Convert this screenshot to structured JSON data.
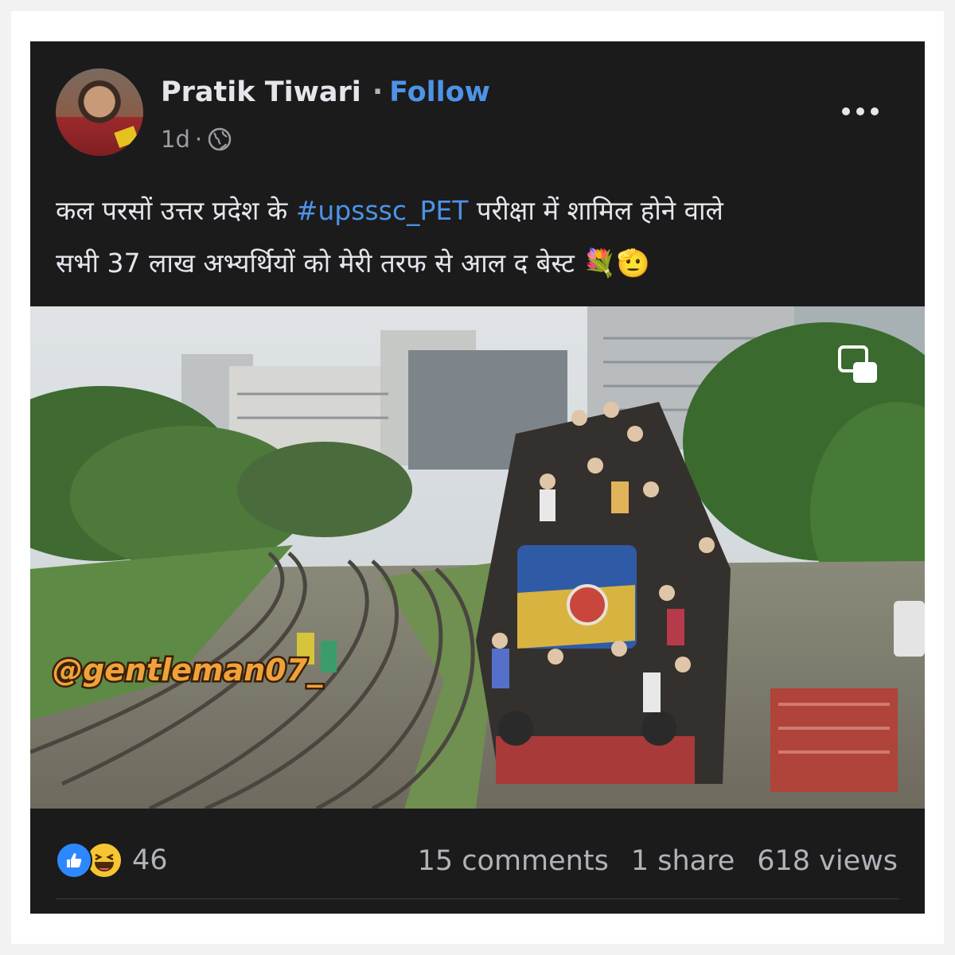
{
  "author": {
    "name": "Pratik Tiwari",
    "separator": "·",
    "follow_label": "Follow",
    "timestamp": "1d",
    "meta_separator": "·",
    "audience_icon": "globe-icon"
  },
  "post": {
    "caption_line1_before": "कल परसों उत्तर प्रदेश के ",
    "hashtag": "#upsssc_PET",
    "caption_line1_after": " परीक्षा में शामिल होने वाले",
    "caption_line2": "सभी 37 लाख अभ्यर्थियों को मेरी तरफ से आल द बेस्ट",
    "caption_emoji": "💐🫡",
    "media_watermark": "@gentleman07_",
    "media_icon": "picture-in-picture-icon"
  },
  "footer": {
    "reaction_icons": [
      "like-icon",
      "haha-icon"
    ],
    "reaction_count": "46",
    "comments": "15 comments",
    "shares": "1 share",
    "views": "618 views"
  },
  "colors": {
    "background": "#1b1b1c",
    "accent": "#4d93e8",
    "text_primary": "#e4e6eb",
    "text_secondary": "#b0b3b8",
    "like_blue": "#2d88ff",
    "haha_yellow": "#f7c531"
  }
}
